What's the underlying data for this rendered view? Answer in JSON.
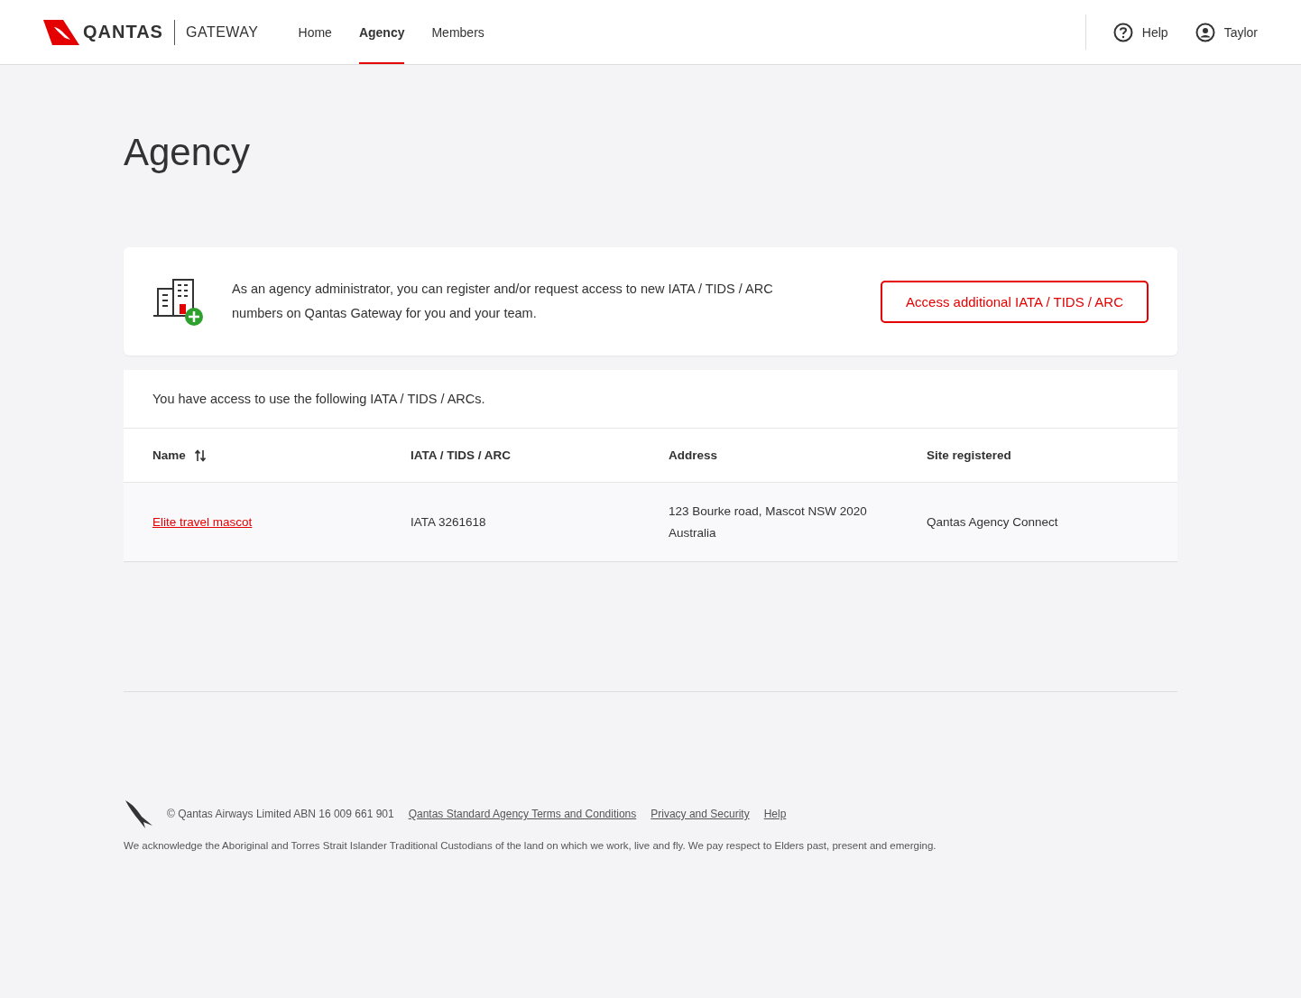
{
  "header": {
    "brand": "QANTAS",
    "product": "GATEWAY",
    "nav": [
      {
        "label": "Home",
        "selected": false
      },
      {
        "label": "Agency",
        "selected": true
      },
      {
        "label": "Members",
        "selected": false
      }
    ],
    "help": "Help",
    "user": "Taylor"
  },
  "page_title": "Agency",
  "notice": {
    "text": "As an agency administrator, you can register and/or request access to new IATA / TIDS / ARC numbers on Qantas Gateway for you and your team.",
    "button": "Access additional IATA / TIDS / ARC"
  },
  "table": {
    "intro": "You have access to use the following IATA / TIDS / ARCs.",
    "columns": [
      {
        "label": "Name",
        "sortable": true
      },
      {
        "label": "IATA / TIDS / ARC",
        "sortable": false
      },
      {
        "label": "Address",
        "sortable": false
      },
      {
        "label": "Site registered",
        "sortable": false
      }
    ],
    "rows": [
      [
        "Elite travel mascot",
        "IATA 3261618",
        "123 Bourke road, Mascot NSW 2020 Australia",
        "Qantas Agency Connect"
      ]
    ]
  },
  "footer": {
    "copyright": "© Qantas Airways Limited  ABN 16 009 661 901",
    "links": [
      "Qantas Standard Agency Terms and Conditions",
      "Privacy and Security",
      "Help"
    ],
    "acknowledgement": "We acknowledge the Aboriginal and Torres Strait Islander Traditional Custodians of the land on which we work, live and fly. We pay respect to Elders past, present and emerging."
  }
}
